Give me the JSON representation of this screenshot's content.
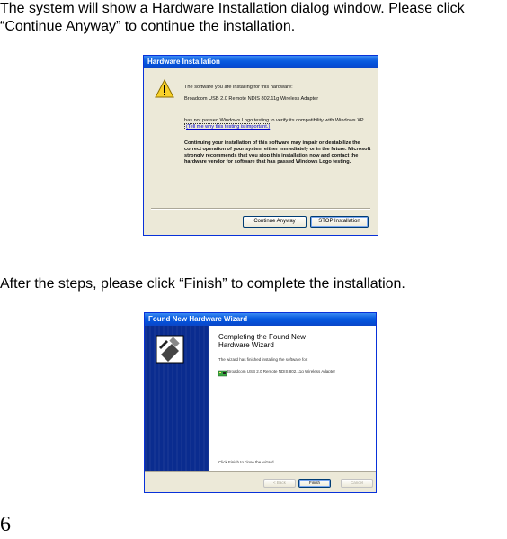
{
  "instructions": {
    "para1": "The system will show a Hardware Installation dialog window. Please click “Continue Anyway” to continue the installation.",
    "para2": "After the steps, please click “Finish” to complete the installation."
  },
  "hardware_dialog": {
    "title": "Hardware Installation",
    "line1": "The software you are installing for this hardware:",
    "device": "Broadcom USB 2.0 Remote NDIS 802.11g Wireless Adapter",
    "logo_text": "has not passed Windows Logo testing to verify its compatibility with Windows XP.",
    "logo_link": "(Tell me why this testing is important.)",
    "warning": "Continuing your installation of this software may impair or destabilize the correct operation of your system either immediately or in the future. Microsoft strongly recommends that you stop this installation now and contact the hardware vendor for software that has passed Windows Logo testing.",
    "continue_button": "Continue Anyway",
    "stop_button": "STOP Installation"
  },
  "wizard": {
    "title": "Found New Hardware Wizard",
    "heading": "Completing the Found New Hardware Wizard",
    "finished_text": "The wizard has finished installing the software for:",
    "device": "Broadcom USB 2.0 Remote NDIS 802.11g Wireless Adapter",
    "close_text": "Click Finish to close the wizard.",
    "back_button": "< Back",
    "finish_button": "Finish",
    "cancel_button": "Cancel"
  },
  "page_number": "6"
}
